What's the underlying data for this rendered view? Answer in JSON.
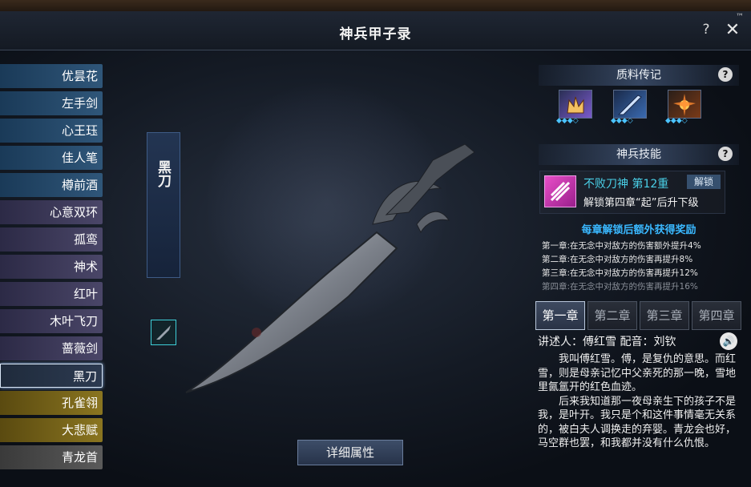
{
  "window": {
    "title": "神兵甲子录",
    "help_label": "?",
    "close_label": "✕",
    "corner_tag": "™"
  },
  "weapons": [
    {
      "label": "优昙花",
      "tier": "blue"
    },
    {
      "label": "左手剑",
      "tier": "blue"
    },
    {
      "label": "心王珏",
      "tier": "blue"
    },
    {
      "label": "佳人笔",
      "tier": "blue"
    },
    {
      "label": "樽前酒",
      "tier": "blue"
    },
    {
      "label": "心意双环",
      "tier": "purple"
    },
    {
      "label": "孤鸾",
      "tier": "purple"
    },
    {
      "label": "神术",
      "tier": "purple"
    },
    {
      "label": "红叶",
      "tier": "purple"
    },
    {
      "label": "木叶飞刀",
      "tier": "purple"
    },
    {
      "label": "蔷薇剑",
      "tier": "purple"
    },
    {
      "label": "黑刀",
      "tier": "selected"
    },
    {
      "label": "孔雀翎",
      "tier": "gold"
    },
    {
      "label": "大悲赋",
      "tier": "gold"
    },
    {
      "label": "青龙首",
      "tier": "gray"
    }
  ],
  "banner": {
    "name": "黑刀"
  },
  "detail_button": "详细属性",
  "material": {
    "heading": "质料传记",
    "help_label": "?",
    "items": [
      {
        "icon": "material-crown-icon",
        "stars": "◆◆◆◇"
      },
      {
        "icon": "material-blade-icon",
        "stars": "◆◆◆◇"
      },
      {
        "icon": "material-spark-icon",
        "stars": "◆◆◆◇"
      }
    ]
  },
  "skill": {
    "heading": "神兵技能",
    "help_label": "?",
    "name": "不败刀神 第12重",
    "unlock": "解锁",
    "desc": "解锁第四章“起”后升下级"
  },
  "rewards": {
    "title": "每章解锁后额外获得奖励",
    "lines": [
      "第一章:在无念中对敌方的伤害额外提升4%",
      "第二章:在无念中对敌方的伤害再提升8%",
      "第三章:在无念中对敌方的伤害再提升12%",
      "第四章:在无念中对敌方的伤害再提升16%"
    ]
  },
  "chapters": [
    "第一章",
    "第二章",
    "第三章",
    "第四章"
  ],
  "narrator": "讲述人：傅红雪 配音：刘钦",
  "story": [
    "我叫傅红雪。傅，是复仇的意思。而红雪，则是母亲记忆中父亲死的那一晚，雪地里氤氲开的红色血迹。",
    "后来我知道那一夜母亲生下的孩子不是我，是叶开。我只是个和这件事情毫无关系的，被白夫人调换走的弃婴。青龙会也好，马空群也罢，和我都并没有什么仇恨。"
  ]
}
